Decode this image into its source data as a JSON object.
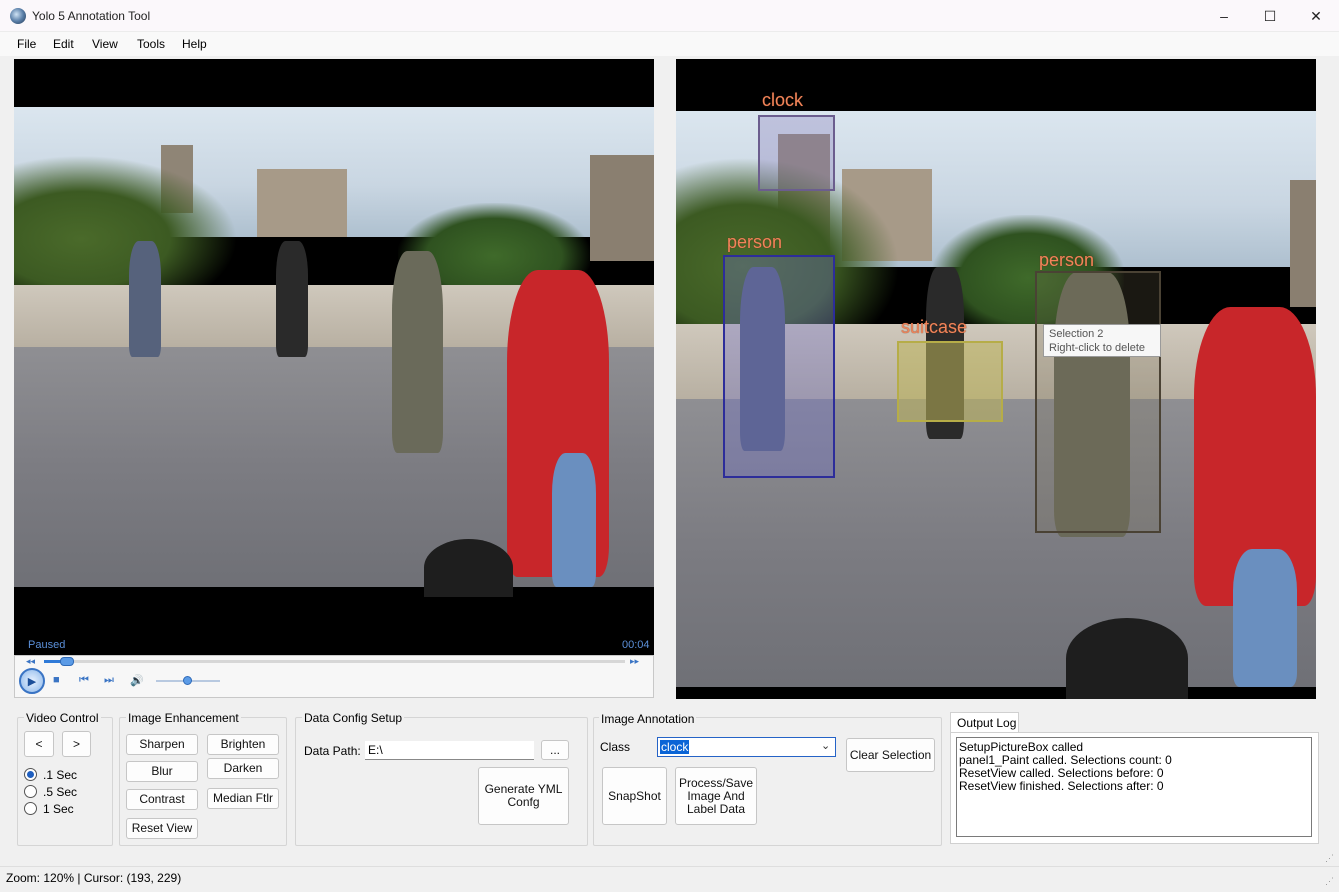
{
  "window": {
    "title": "Yolo 5 Annotation Tool",
    "minimize_glyph": "–",
    "maximize_glyph": "☐",
    "close_glyph": "✕",
    "icon": "app-icon"
  },
  "menu": [
    "File",
    "Edit",
    "View",
    "Tools",
    "Help"
  ],
  "player": {
    "state": "Paused",
    "time": "00:04",
    "seek_progress": 0.04,
    "volume_level": 0.5,
    "icons": [
      "play-icon",
      "stop-icon",
      "previous-icon",
      "next-icon",
      "volume-icon",
      "rewind-icon",
      "fast-forward-icon"
    ]
  },
  "annotations": [
    {
      "label": "clock",
      "color": "#6b5d8e"
    },
    {
      "label": "person",
      "color": "#2d2d9a"
    },
    {
      "label": "suitcase",
      "color": "#b6ad48"
    },
    {
      "label": "person",
      "color": "#4a4234"
    }
  ],
  "tooltip": {
    "line1": "Selection 2",
    "line2": "Right-click to delete"
  },
  "video_control": {
    "title": "Video Control",
    "prev": "<",
    "next": ">",
    "options": [
      ".1 Sec",
      ".5 Sec",
      "1 Sec"
    ],
    "selected": ".1 Sec"
  },
  "image_enhancement": {
    "title": "Image Enhancement",
    "buttons": [
      "Sharpen",
      "Brighten",
      "Blur",
      "Darken",
      "Contrast",
      "Median Ftlr",
      "Reset View"
    ]
  },
  "data_config": {
    "title": "Data Config Setup",
    "path_label": "Data Path:",
    "path_value": "E:\\",
    "browse": "...",
    "generate_line1": "Generate YML",
    "generate_line2": "Confg"
  },
  "image_annotation": {
    "title": "Image Annotation",
    "class_label": "Class",
    "class_value": "clock",
    "clear": "Clear Selection",
    "snapshot": "SnapShot",
    "process_line1": "Process/Save",
    "process_line2": "Image And",
    "process_line3": "Label Data"
  },
  "output_log": {
    "tab": "Output Log",
    "lines": [
      "SetupPictureBox called",
      "panel1_Paint called. Selections count: 0",
      "ResetView called. Selections before: 0",
      "ResetView finished. Selections after: 0"
    ]
  },
  "status": "Zoom: 120% | Cursor: (193, 229)"
}
